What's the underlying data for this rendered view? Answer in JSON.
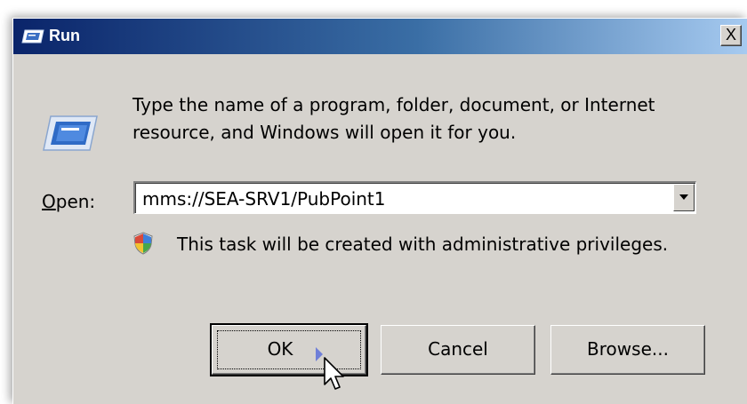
{
  "window": {
    "title": "Run",
    "close_label": "X"
  },
  "dialog": {
    "description": "Type the name of a program, folder, document, or Internet resource, and Windows will open it for you.",
    "open_label_first": "O",
    "open_label_rest": "pen:",
    "open_value": "mms://SEA-SRV1/PubPoint1",
    "admin_note": "This task will be created with administrative privileges."
  },
  "buttons": {
    "ok": "OK",
    "cancel": "Cancel",
    "browse": "Browse..."
  },
  "icons": {
    "title": "run-icon",
    "main": "run-icon",
    "shield": "uac-shield-icon",
    "cursor": "mouse-pointer-icon"
  },
  "colors": {
    "titlebar_start": "#0a246a",
    "titlebar_end": "#a6caf0",
    "dialog_bg": "#d6d3ce"
  }
}
